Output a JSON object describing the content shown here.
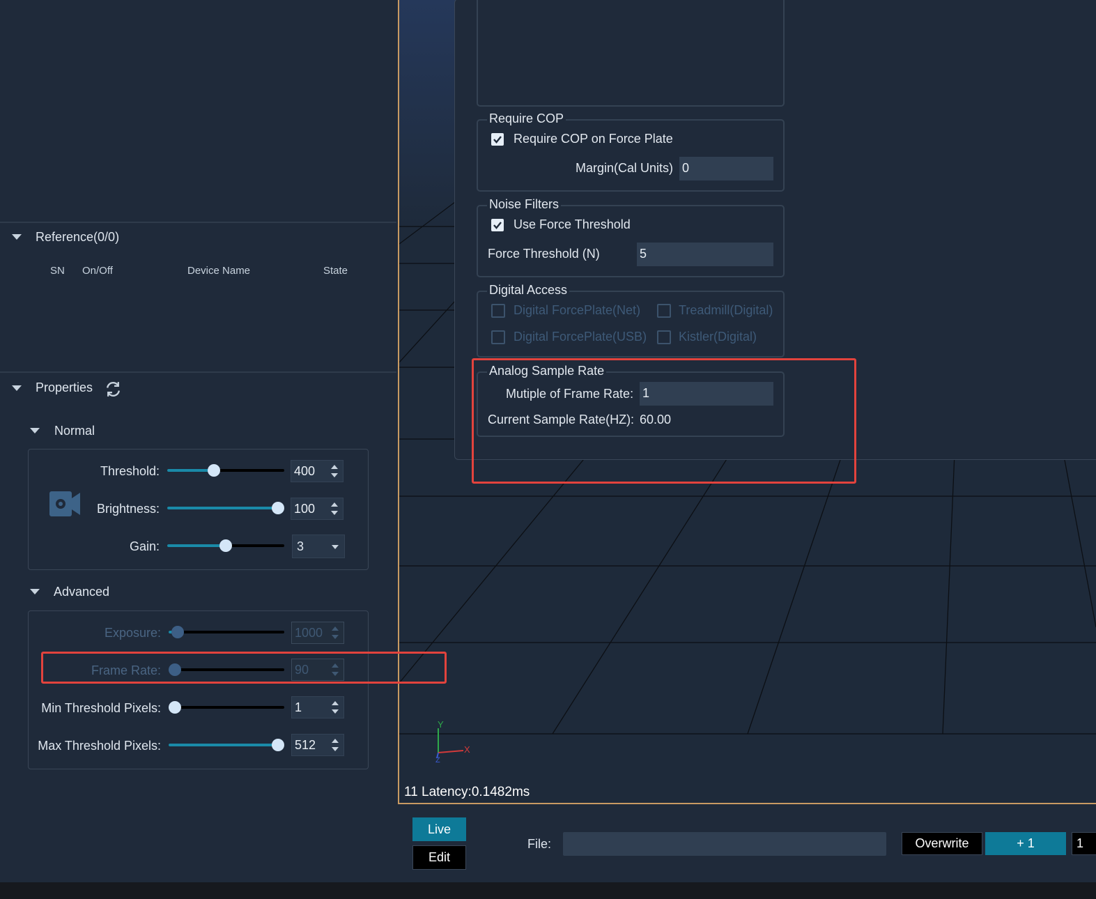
{
  "reference": {
    "title": "Reference(0/0)",
    "columns": [
      "SN",
      "On/Off",
      "Device Name",
      "State"
    ]
  },
  "properties": {
    "title": "Properties",
    "normal": {
      "title": "Normal",
      "threshold": {
        "label": "Threshold:",
        "value": "400",
        "fraction": 0.4
      },
      "brightness": {
        "label": "Brightness:",
        "value": "100",
        "fraction": 1.0
      },
      "gain": {
        "label": "Gain:",
        "value": "3",
        "fraction": 0.5
      }
    },
    "advanced": {
      "title": "Advanced",
      "exposure": {
        "label": "Exposure:",
        "value": "1000",
        "fraction": 0.08
      },
      "frame_rate": {
        "label": "Frame Rate:",
        "value": "90",
        "fraction": 0.04
      },
      "min_threshold": {
        "label": "Min Threshold Pixels:",
        "value": "1",
        "fraction": 0.0
      },
      "max_threshold": {
        "label": "Max Threshold Pixels:",
        "value": "512",
        "fraction": 1.0
      }
    }
  },
  "dialog": {
    "require_cop": {
      "title": "Require COP",
      "checkbox_label": "Require COP on Force Plate",
      "checked": true,
      "margin_label": "Margin(Cal Units)",
      "margin_value": "0"
    },
    "noise_filters": {
      "title": "Noise Filters",
      "checkbox_label": "Use Force Threshold",
      "checked": true,
      "threshold_label": "Force Threshold (N)",
      "threshold_value": "5"
    },
    "digital_access": {
      "title": "Digital Access",
      "options": [
        "Digital ForcePlate(Net)",
        "Treadmill(Digital)",
        "Digital ForcePlate(USB)",
        "Kistler(Digital)"
      ]
    },
    "analog_sample_rate": {
      "title": "Analog Sample Rate",
      "multiple_label": "Mutiple of Frame Rate:",
      "multiple_value": "1",
      "current_label": "Current Sample Rate(HZ):",
      "current_value": "60.00"
    }
  },
  "viewport": {
    "axis_y": "Y",
    "axis_x": "X",
    "axis_z": "Z",
    "status": "11 Latency:0.1482ms"
  },
  "toolbar": {
    "live": "Live",
    "edit": "Edit",
    "file_label": "File:",
    "file_value": "",
    "overwrite": "Overwrite",
    "plus_one": "+ 1",
    "counter": "1"
  },
  "colors": {
    "accent": "#0e7a98",
    "highlight": "#e2433d",
    "background": "#1f2a3a",
    "viewport_border": "#c89a62"
  }
}
